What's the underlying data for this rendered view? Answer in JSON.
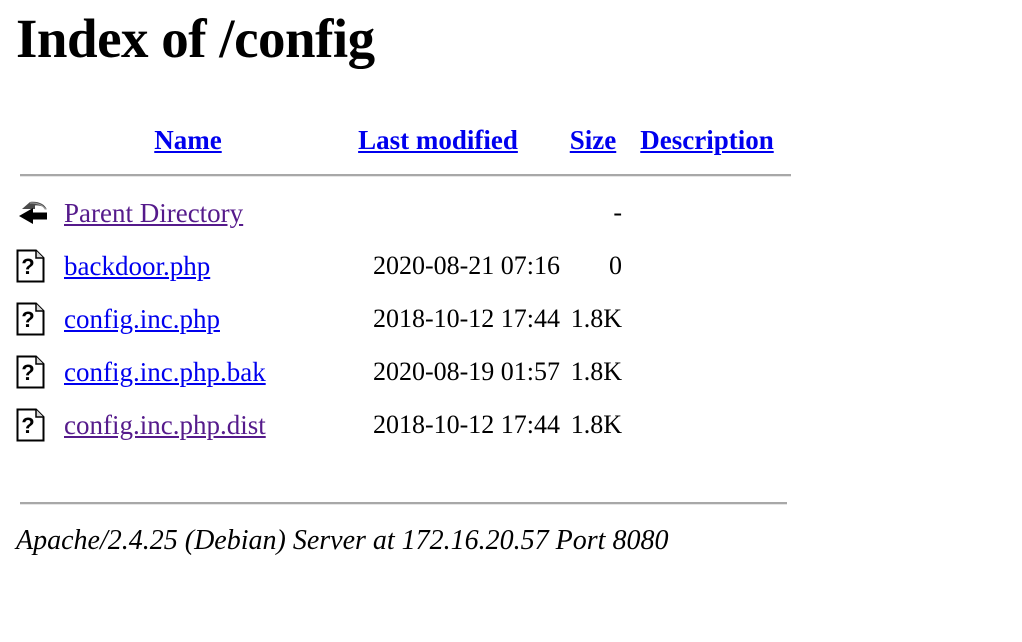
{
  "page": {
    "title": "Index of /config"
  },
  "table": {
    "headers": {
      "icon": "",
      "name": "Name",
      "last_modified": "Last modified",
      "size": "Size",
      "description": "Description"
    },
    "rows": [
      {
        "icon": "back-arrow-icon",
        "name": "Parent Directory",
        "link_state": "visited",
        "last_modified": "",
        "size": "-",
        "description": ""
      },
      {
        "icon": "unknown-file-icon",
        "name": "backdoor.php",
        "link_state": "unvisited",
        "last_modified": "2020-08-21 07:16",
        "size": "0",
        "description": ""
      },
      {
        "icon": "unknown-file-icon",
        "name": "config.inc.php",
        "link_state": "unvisited",
        "last_modified": "2018-10-12 17:44",
        "size": "1.8K",
        "description": ""
      },
      {
        "icon": "unknown-file-icon",
        "name": "config.inc.php.bak",
        "link_state": "unvisited",
        "last_modified": "2020-08-19 01:57",
        "size": "1.8K",
        "description": ""
      },
      {
        "icon": "unknown-file-icon",
        "name": "config.inc.php.dist",
        "link_state": "visited",
        "last_modified": "2018-10-12 17:44",
        "size": "1.8K",
        "description": ""
      }
    ]
  },
  "footer": {
    "signature": "Apache/2.4.25 (Debian) Server at 172.16.20.57 Port 8080"
  },
  "colors": {
    "link_unvisited": "#0000ee",
    "link_visited": "#551a8b",
    "text": "#000000",
    "background": "#ffffff",
    "rule": "#a8a8a8"
  }
}
